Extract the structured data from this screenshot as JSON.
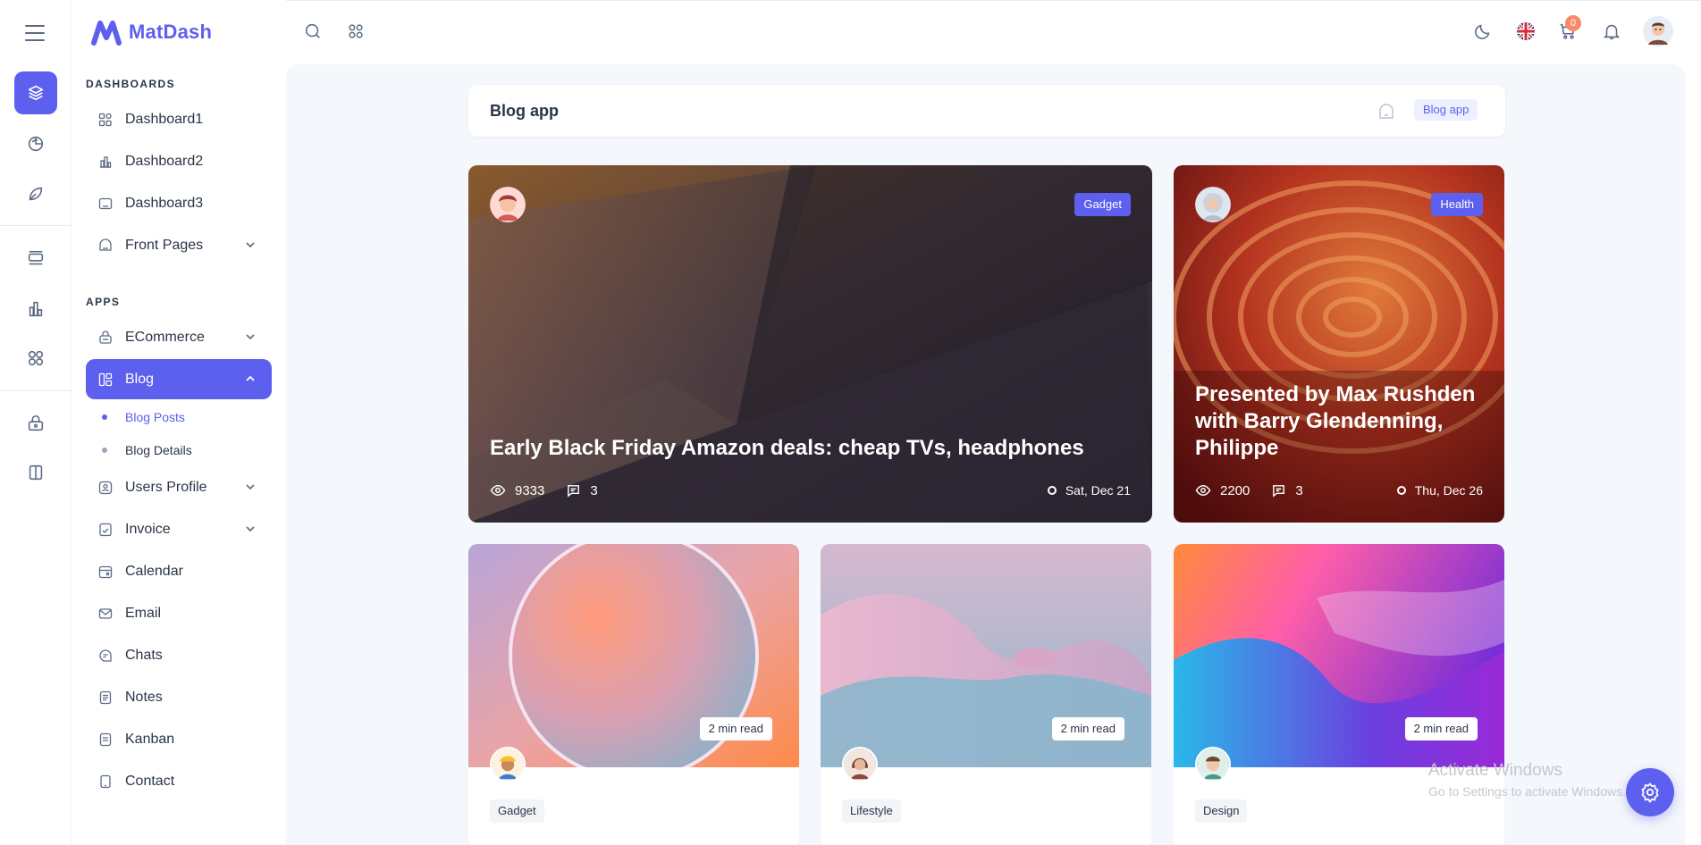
{
  "brand": {
    "name": "MatDash",
    "accent": "#5d5fef"
  },
  "rail": {
    "icons": [
      "layers-icon",
      "chart-pie-icon",
      "leaf-icon",
      "layout-icon",
      "bar-chart-icon",
      "apps-icon",
      "lock-icon",
      "book-icon"
    ]
  },
  "sidebar": {
    "dashboards_title": "DASHBOARDS",
    "apps_title": "APPS",
    "dashboards": [
      {
        "label": "Dashboard1",
        "icon": "aperture-icon"
      },
      {
        "label": "Dashboard2",
        "icon": "chart-icon"
      },
      {
        "label": "Dashboard3",
        "icon": "screen-icon"
      },
      {
        "label": "Front Pages",
        "icon": "home-icon"
      }
    ],
    "apps": [
      {
        "label": "ECommerce",
        "icon": "basket-icon"
      },
      {
        "label": "Blog",
        "icon": "blog-icon"
      },
      {
        "label": "Users Profile",
        "icon": "user-icon"
      },
      {
        "label": "Invoice",
        "icon": "file-check-icon"
      },
      {
        "label": "Calendar",
        "icon": "calendar-icon"
      },
      {
        "label": "Email",
        "icon": "mail-icon"
      },
      {
        "label": "Chats",
        "icon": "message-icon"
      },
      {
        "label": "Notes",
        "icon": "notes-icon"
      },
      {
        "label": "Kanban",
        "icon": "kanban-icon"
      },
      {
        "label": "Contact",
        "icon": "phone-icon"
      }
    ],
    "blog_sub": [
      {
        "label": "Blog Posts"
      },
      {
        "label": "Blog Details"
      }
    ]
  },
  "header": {
    "cart_count": "0"
  },
  "page": {
    "title": "Blog app",
    "breadcrumb_current": "Blog app"
  },
  "featured": [
    {
      "title": "Early Black Friday Amazon deals: cheap TVs, headphones",
      "tag": "Gadget",
      "views": "9333",
      "comments": "3",
      "date": "Sat, Dec 21"
    },
    {
      "title": "Presented by Max Rushden with Barry Glendenning, Philippe",
      "tag": "Health",
      "views": "2200",
      "comments": "3",
      "date": "Thu, Dec 26"
    }
  ],
  "posts": [
    {
      "read_time": "2 min read",
      "category": "Gadget"
    },
    {
      "read_time": "2 min read",
      "category": "Lifestyle"
    },
    {
      "read_time": "2 min read",
      "category": "Design"
    }
  ],
  "watermark": {
    "line1": "Activate Windows",
    "line2": "Go to Settings to activate Windows."
  }
}
